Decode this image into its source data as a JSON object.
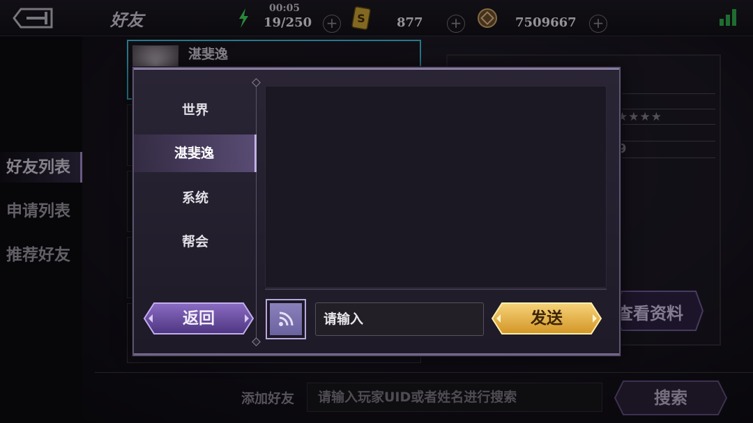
{
  "header": {
    "title": "好友",
    "timer": "00:05",
    "stamina": "19/250",
    "tickets": "877",
    "coins": "7509667",
    "icons": [
      "back-arrow-icon",
      "energy-bolt-icon",
      "ticket-icon",
      "coin-icon",
      "signal-icon"
    ]
  },
  "left_tabs": {
    "friend_list": "好友列表",
    "request_list": "申请列表",
    "recommended": "推荐好友"
  },
  "friend_list": {
    "selected_name": "湛斐逸",
    "bottom_partial": "……………"
  },
  "detail": {
    "level_partial": "9",
    "view_profile": "查看资料"
  },
  "search": {
    "label": "添加好友",
    "placeholder": "请输入玩家UID或者姓名进行搜索",
    "button": "搜索"
  },
  "chat_modal": {
    "channels": [
      "世界",
      "湛斐逸",
      "系统",
      "帮会"
    ],
    "active_channel": "湛斐逸",
    "input_placeholder": "请输入",
    "back_button": "返回",
    "send_button": "发送"
  },
  "colors": {
    "accent_purple": "#9a8cb4",
    "send_gold": "#e9b44a",
    "selection_cyan": "#3ab8d4"
  }
}
